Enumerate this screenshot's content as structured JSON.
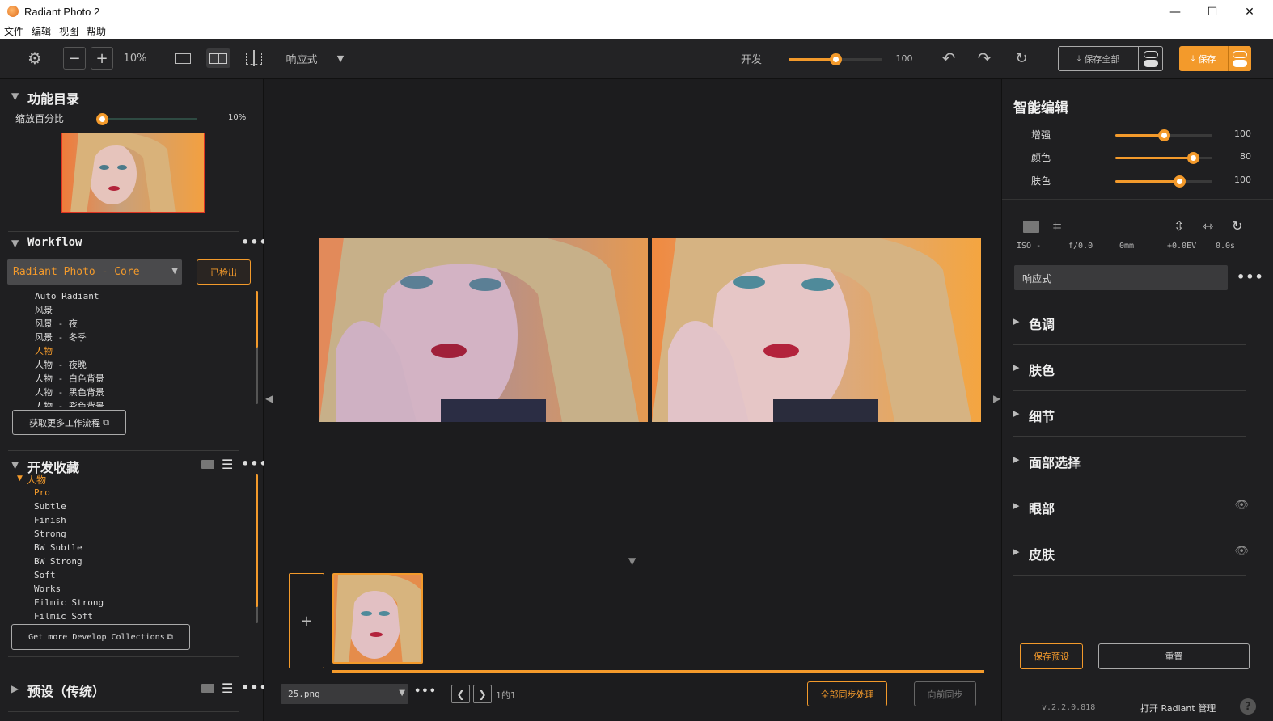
{
  "window": {
    "title": "Radiant Photo 2",
    "minimize": "—",
    "maximize": "☐",
    "close": "✕"
  },
  "menu": [
    "文件",
    "编辑",
    "视图",
    "帮助"
  ],
  "toolbar": {
    "zoom": "10%",
    "mode": "响应式",
    "develop_label": "开发",
    "develop_value": "100",
    "develop_level": 0.5,
    "save_all": "保存全部",
    "save": "保存"
  },
  "left": {
    "catalog_title": "功能目录",
    "zoom_label": "缩放百分比",
    "zoom_value": "10%",
    "zoom_level": 0.0,
    "workflow_title": "Workflow",
    "workflow_select": "Radiant Photo - Core",
    "checked_out": "已检出",
    "workflow_items": [
      "Auto Radiant",
      "风景",
      "风景 - 夜",
      "风景 - 冬季",
      "人物",
      "人物 - 夜晚",
      "人物 - 白色背景",
      "人物 - 黑色背景",
      "人物 - 彩色背景"
    ],
    "workflow_selected": 4,
    "get_more_workflows": "获取更多工作流程",
    "collections_title": "开发收藏",
    "collection_group": "人物",
    "collection_items": [
      "Pro",
      "Subtle",
      "Finish",
      "Strong",
      "BW Subtle",
      "BW Strong",
      "Soft",
      "Works",
      "Filmic Strong",
      "Filmic Soft"
    ],
    "collection_selected": 0,
    "get_more_collections": "Get more Develop Collections",
    "presets_title": "预设（传统）"
  },
  "center": {
    "file_name": "25.png",
    "page_info": "1的1",
    "sync_all": "全部同步处理",
    "sync_forward": "向前同步",
    "add": "+"
  },
  "right": {
    "smart_title": "智能编辑",
    "sliders": [
      {
        "label": "增强",
        "value": "100",
        "level": 0.5
      },
      {
        "label": "颜色",
        "value": "80",
        "level": 0.8
      },
      {
        "label": "肤色",
        "value": "100",
        "level": 0.66
      }
    ],
    "exif": [
      "ISO -",
      "f/0.0",
      "0mm",
      "+0.0EV",
      "0.0s"
    ],
    "preset_mode": "响应式",
    "sections": [
      "色调",
      "肤色",
      "细节",
      "面部选择",
      "眼部",
      "皮肤"
    ],
    "save_preset": "保存预设",
    "reset": "重置",
    "version": "v.2.2.0.818",
    "open_manager": "打开 Radiant 管理",
    "help": "?"
  }
}
